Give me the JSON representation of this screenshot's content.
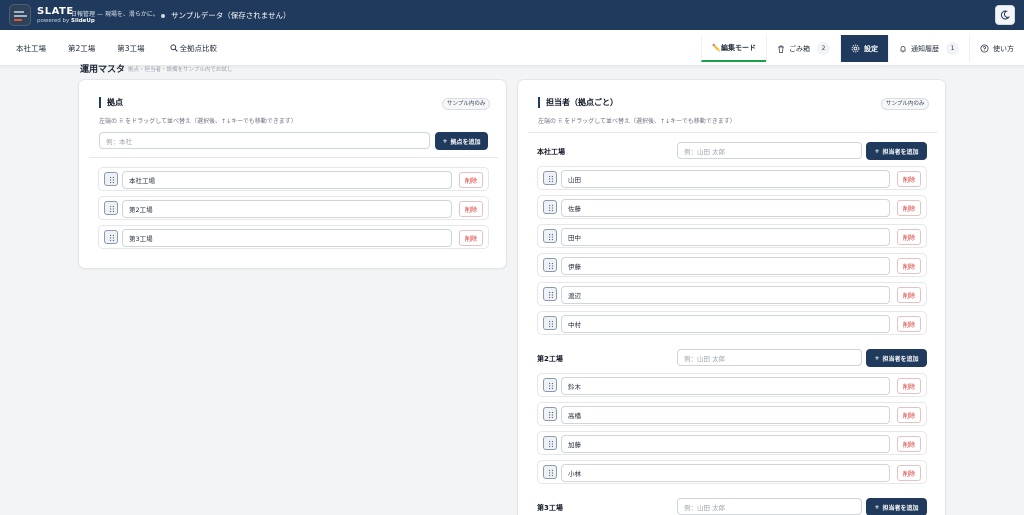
{
  "header": {
    "brand": "SLATE",
    "tagline": "日報管理 — 現場を、滑らかに。",
    "powered_prefix": "powered by ",
    "powered_name": "SlideUp",
    "sample_status": "サンプルデータ（保存されません）"
  },
  "nav": {
    "tabs": [
      "本社工場",
      "第2工場",
      "第3工場",
      "全拠点比較"
    ],
    "edit_mode": "✏️編集モード",
    "trash": "ごみ箱",
    "trash_count": "2",
    "settings": "設定",
    "notifications": "通知履歴",
    "notifications_count": "1",
    "help": "使い方"
  },
  "section": {
    "title": "運用マスタ",
    "subtitle": "拠点・担当者・設備をサンプル内でお試し"
  },
  "bases": {
    "title": "拠点",
    "sample_pill": "サンプル内のみ",
    "help": "左端の ⠿ をドラッグして並べ替え（選択後、↑↓キーでも移動できます）",
    "input_placeholder": "例：本社",
    "add_label": "拠点を追加",
    "delete_label": "削除",
    "items": [
      "本社工場",
      "第2工場",
      "第3工場"
    ]
  },
  "staff": {
    "title": "担当者（拠点ごと）",
    "sample_pill": "サンプル内のみ",
    "help": "左端の ⠿ をドラッグして並べ替え（選択後、↑↓キーでも移動できます）",
    "input_placeholder": "例：山田 太郎",
    "add_label": "担当者を追加",
    "delete_label": "削除",
    "groups": [
      {
        "name": "本社工場",
        "members": [
          "山田",
          "佐藤",
          "田中",
          "伊藤",
          "渡辺",
          "中村"
        ]
      },
      {
        "name": "第2工場",
        "members": [
          "鈴木",
          "高橋",
          "加藤",
          "小林"
        ]
      },
      {
        "name": "第3工場",
        "members": []
      }
    ]
  },
  "colors": {
    "header_bg": "#1f3a5c",
    "accent_green": "#16a34a",
    "delete_red": "#dc2626"
  }
}
